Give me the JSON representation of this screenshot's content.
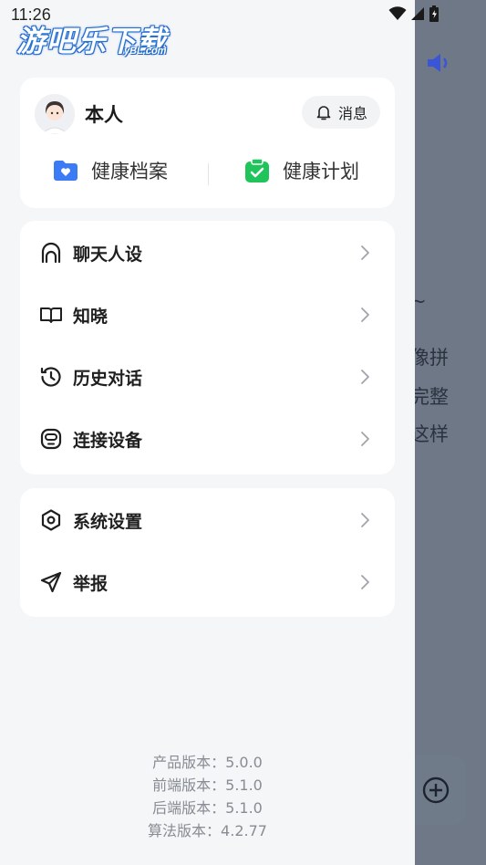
{
  "status_bar": {
    "time": "11:26"
  },
  "watermark": {
    "main": "游吧乐下载",
    "sub": "yBL.com"
  },
  "background_app": {
    "partial_lines": [
      "~",
      "像拼",
      "完整",
      "这样"
    ]
  },
  "profile": {
    "name": "本人",
    "message_button": "消息",
    "quick_links": [
      {
        "label": "健康档案",
        "icon": "folder-heart-icon",
        "color": "#3b7cf5"
      },
      {
        "label": "健康计划",
        "icon": "checklist-icon",
        "color": "#1fc45a"
      }
    ]
  },
  "menu_group_1": [
    {
      "label": "聊天人设",
      "icon": "persona-icon"
    },
    {
      "label": "知晓",
      "icon": "book-icon"
    },
    {
      "label": "历史对话",
      "icon": "history-clock-icon"
    },
    {
      "label": "连接设备",
      "icon": "device-icon"
    }
  ],
  "menu_group_2": [
    {
      "label": "系统设置",
      "icon": "settings-icon"
    },
    {
      "label": "举报",
      "icon": "report-send-icon"
    }
  ],
  "versions": [
    "产品版本：5.0.0",
    "前端版本：5.1.0",
    "后端版本：5.1.0",
    "算法版本：4.2.77"
  ]
}
